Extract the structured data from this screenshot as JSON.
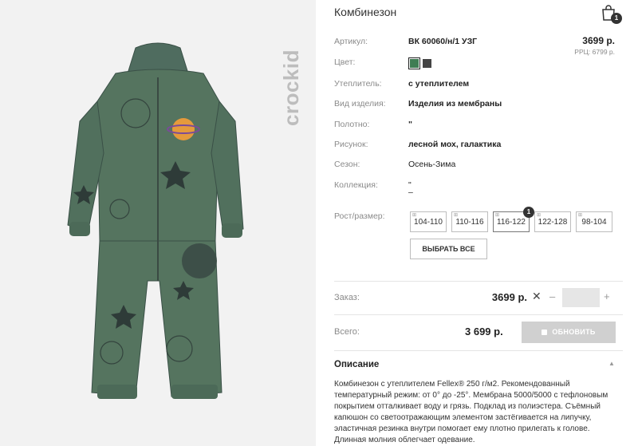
{
  "brand": "crockid",
  "product": {
    "title": "Комбинезон",
    "price": "3699 р.",
    "rrp": "РРЦ: 6799 р."
  },
  "cart": {
    "count": "1"
  },
  "attributes": [
    {
      "label": "Артикул:",
      "value": "ВК 60060/н/1 УЗГ"
    },
    {
      "label": "Цвет:",
      "value": ""
    },
    {
      "label": "Утеплитель:",
      "value": "с утеплителем"
    },
    {
      "label": "Вид изделия:",
      "value": "Изделия из мембраны"
    },
    {
      "label": "Полотно:",
      "value": "\""
    },
    {
      "label": "Рисунок:",
      "value": "лесной мох, галактика"
    },
    {
      "label": "Сезон:",
      "value": "Осень-Зима"
    },
    {
      "label": "Коллекция:",
      "value": "\"",
      "value2": "–"
    },
    {
      "label": "Рост/размер:",
      "value": ""
    }
  ],
  "colors": [
    "#3f7d53",
    "#444444"
  ],
  "sizes": [
    {
      "label": "104-110",
      "selected": false
    },
    {
      "label": "110-116",
      "selected": false
    },
    {
      "label": "116-122",
      "selected": true,
      "badge": "1"
    },
    {
      "label": "122-128",
      "selected": false
    },
    {
      "label": "98-104",
      "selected": false
    }
  ],
  "select_all_label": "ВЫБРАТЬ ВСЕ",
  "order": {
    "label": "Заказ:",
    "price": "3699 р.",
    "remove": "✕",
    "minus": "–",
    "plus": "+",
    "quantity": ""
  },
  "total": {
    "label": "Всего:",
    "value": "3 699 р.",
    "button_label": "ОБНОВИТЬ"
  },
  "description": {
    "title": "Описание",
    "toggle": "▲",
    "text": "Комбинезон с утеплителем Fellex® 250 г/м2. Рекомендованный температурный режим: от 0° до -25°. Мембрана 5000/5000 с тефлоновым покрытием отталкивает воду и грязь. Подклад из полиэстера. Съёмный капюшон со светоотражающим элементом застёгивается на липучку, эластичная резинка внутри помогает ему плотно прилегать к голове. Длинная молния облегчает одевание."
  }
}
